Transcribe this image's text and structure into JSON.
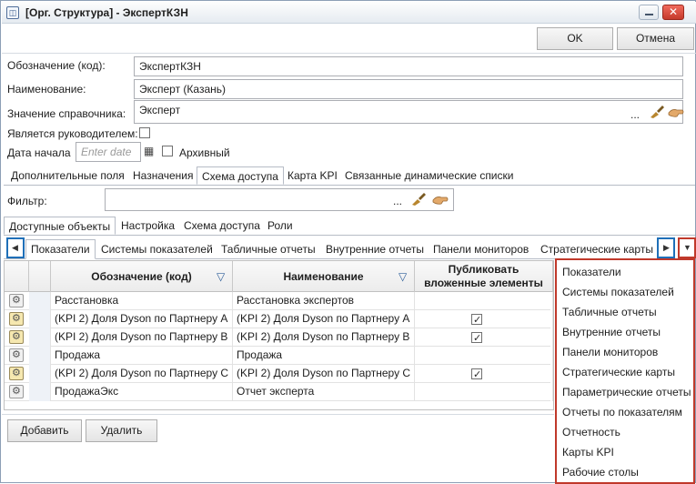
{
  "window": {
    "title": "[Орг. Структура] - ЭкспертКЗН",
    "title_icon": "structure-icon"
  },
  "buttons": {
    "ok": "OK",
    "cancel": "Отмена",
    "add": "Добавить",
    "delete": "Удалить"
  },
  "form": {
    "code_label": "Обозначение (код):",
    "code_value": "ЭкспертКЗН",
    "name_label": "Наименование:",
    "name_value": "Эксперт (Казань)",
    "ref_label": "Значение справочника:",
    "ref_value": "Эксперт",
    "ellipsis": "...",
    "is_head_label": "Является руководителем:",
    "is_head_checked": false,
    "start_date_label": "Дата начала",
    "start_date_placeholder": "Enter date",
    "archive_label": "Архивный",
    "archive_checked": false
  },
  "main_tabs": [
    "Дополнительные поля",
    "Назначения",
    "Схема доступа",
    "Карта KPI",
    "Связанные динамические списки"
  ],
  "main_tab_active": 2,
  "filter": {
    "label": "Фильтр:",
    "value": "",
    "ellipsis": "..."
  },
  "sub_tabs": [
    "Доступные объекты",
    "Настройка",
    "Схема доступа",
    "Роли"
  ],
  "sub_tab_active": 0,
  "object_tabs": [
    "Показатели",
    "Системы показателей",
    "Табличные отчеты",
    "Внутренние отчеты",
    "Панели мониторов",
    "Стратегические карты"
  ],
  "object_tab_active": 0,
  "grid": {
    "columns": [
      "Обозначение (код)",
      "Наименование",
      "Публиковать вложенные элементы"
    ],
    "rows": [
      {
        "code": "Расстановка",
        "name": "Расстановка экспертов",
        "publish": false,
        "icon": "gear"
      },
      {
        "code": "(KPI 2) Доля Dyson по Партнеру А",
        "name": "(KPI 2) Доля Dyson по Партнеру А",
        "publish": true,
        "icon": "folder-gear"
      },
      {
        "code": "(KPI 2) Доля Dyson по Партнеру В",
        "name": "(KPI 2) Доля Dyson по Партнеру В",
        "publish": true,
        "icon": "folder-gear"
      },
      {
        "code": "Продажа",
        "name": "Продажа",
        "publish": false,
        "icon": "gear"
      },
      {
        "code": "(KPI 2) Доля Dyson по Партнеру С",
        "name": "(KPI 2) Доля Dyson по Партнеру С",
        "publish": true,
        "icon": "folder-gear"
      },
      {
        "code": "ПродажаЭкс",
        "name": "Отчет эксперта",
        "publish": false,
        "icon": "gear"
      }
    ]
  },
  "dropdown_menu": [
    "Показатели",
    "Системы показателей",
    "Табличные отчеты",
    "Внутренние отчеты",
    "Панели мониторов",
    "Стратегические карты",
    "Параметрические отчеты",
    "Отчеты по показателям",
    "Отчетность",
    "Карты KPI",
    "Рабочие столы"
  ],
  "colors": {
    "highlight_blue": "#1f6fb8",
    "highlight_red": "#c0392b"
  }
}
